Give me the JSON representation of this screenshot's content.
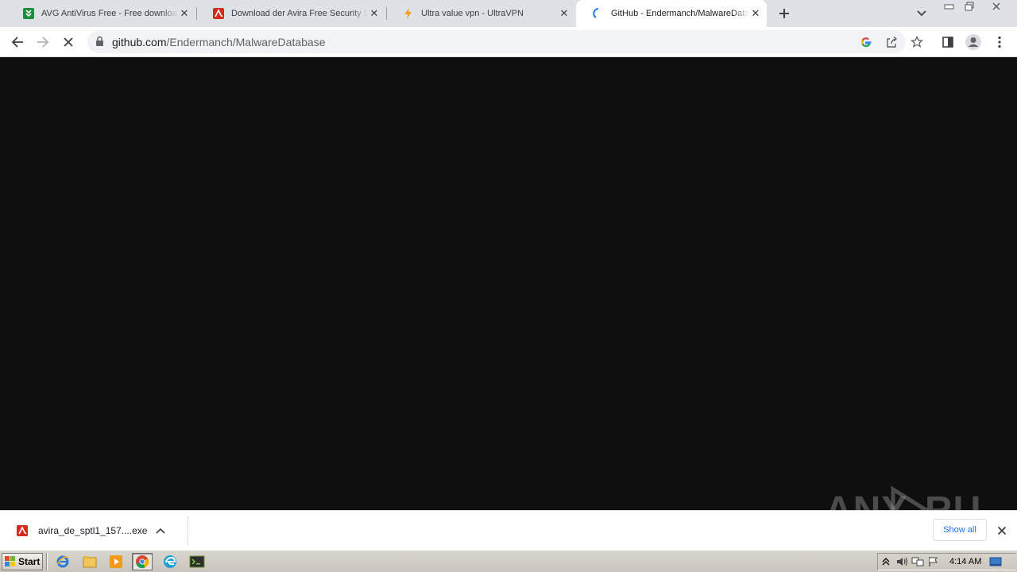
{
  "tabs": [
    {
      "title": "AVG AntiVirus Free - Free download",
      "favicon": "avg-download-icon",
      "color": "#1e8e3e"
    },
    {
      "title": "Download der Avira Free Security Software",
      "favicon": "avira-icon",
      "color": "#d52b1e"
    },
    {
      "title": "Ultra value vpn - UltraVPN",
      "favicon": "lightning-icon",
      "color": "#f4a11f"
    },
    {
      "title": "GitHub - Endermanch/MalwareDatabase",
      "favicon": "loading-spinner-icon",
      "color": "#1a73e8"
    }
  ],
  "omnibox": {
    "host": "github.com",
    "path": "/Endermanch/MalwareDatabase"
  },
  "download": {
    "filename": "avira_de_sptl1_157....exe",
    "show_all": "Show all"
  },
  "watermark": "ANY RUN",
  "taskbar": {
    "start_label": "Start",
    "clock": "4:14 AM"
  },
  "colors": {
    "page_bg": "#0f0f10",
    "tabstrip_bg": "#dee1e6",
    "link_blue": "#1a73e8"
  }
}
